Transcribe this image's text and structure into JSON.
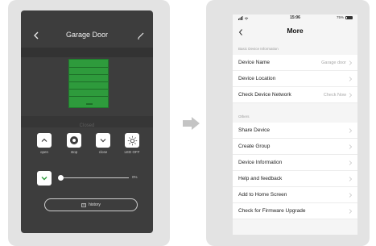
{
  "left_screen": {
    "title": "Garage Door",
    "door_status": "Closed",
    "controls": [
      {
        "label": "open",
        "icon": "chevron-up-icon"
      },
      {
        "label": "stop",
        "icon": "stop-icon"
      },
      {
        "label": "close",
        "icon": "chevron-down-icon"
      },
      {
        "label": "LED OFF",
        "icon": "sun-icon"
      }
    ],
    "slider_value": "0%",
    "slider_level": 0,
    "history_label": "history",
    "accent_green": "#2e9b3c"
  },
  "right_screen": {
    "status_time": "15:06",
    "status_battery": "75%",
    "title": "More",
    "sections": [
      {
        "label": "Basic Device Information",
        "rows": [
          {
            "label": "Device Name",
            "value": "Garage door"
          },
          {
            "label": "Device Location",
            "value": ""
          },
          {
            "label": "Check Device Network",
            "value": "Check Now"
          }
        ]
      },
      {
        "label": "Others",
        "rows": [
          {
            "label": "Share Device",
            "value": ""
          },
          {
            "label": "Create Group",
            "value": ""
          },
          {
            "label": "Device Information",
            "value": ""
          },
          {
            "label": "Help and feedback",
            "value": ""
          },
          {
            "label": "Add to Home Screen",
            "value": ""
          },
          {
            "label": "Check for Firmware Upgrade",
            "value": ""
          }
        ]
      }
    ]
  }
}
